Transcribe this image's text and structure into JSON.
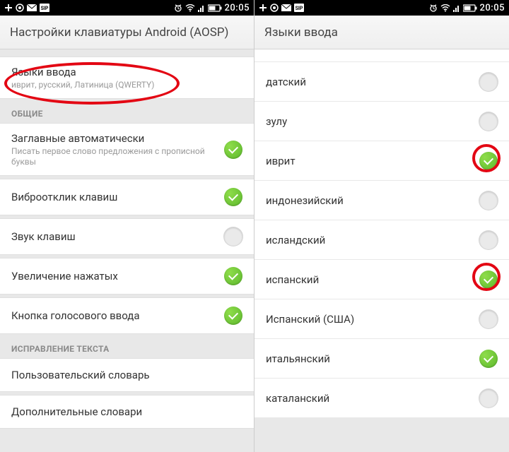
{
  "status": {
    "time": "20:05"
  },
  "left": {
    "header": "Настройки клавиатуры Android (AOSP)",
    "input_languages": {
      "title": "Языки ввода",
      "sub": "иврит, русский, Латиница (QWERTY)"
    },
    "section_general": "ОБЩИЕ",
    "rows": [
      {
        "title": "Заглавные автоматически",
        "sub": "Писать первое слово предложения с прописной буквы",
        "on": true
      },
      {
        "title": "Виброотклик клавиш",
        "sub": "",
        "on": true
      },
      {
        "title": "Звук клавиш",
        "sub": "",
        "on": false
      },
      {
        "title": "Увеличение нажатых",
        "sub": "",
        "on": true
      },
      {
        "title": "Кнопка голосового ввода",
        "sub": "",
        "on": true
      }
    ],
    "section_correction": "ИСПРАВЛЕНИЕ ТЕКСТА",
    "dict1": "Пользовательский словарь",
    "dict2": "Дополнительные словари"
  },
  "right": {
    "header": "Языки ввода",
    "languages": [
      {
        "name": "датский",
        "on": false
      },
      {
        "name": "зулу",
        "on": false
      },
      {
        "name": "иврит",
        "on": true,
        "highlight": true
      },
      {
        "name": "индонезийский",
        "on": false
      },
      {
        "name": "исландский",
        "on": false
      },
      {
        "name": "испанский",
        "on": true,
        "highlight": true
      },
      {
        "name": "Испанский (США)",
        "on": false
      },
      {
        "name": "итальянский",
        "on": true
      },
      {
        "name": "каталанский",
        "on": false
      }
    ]
  }
}
